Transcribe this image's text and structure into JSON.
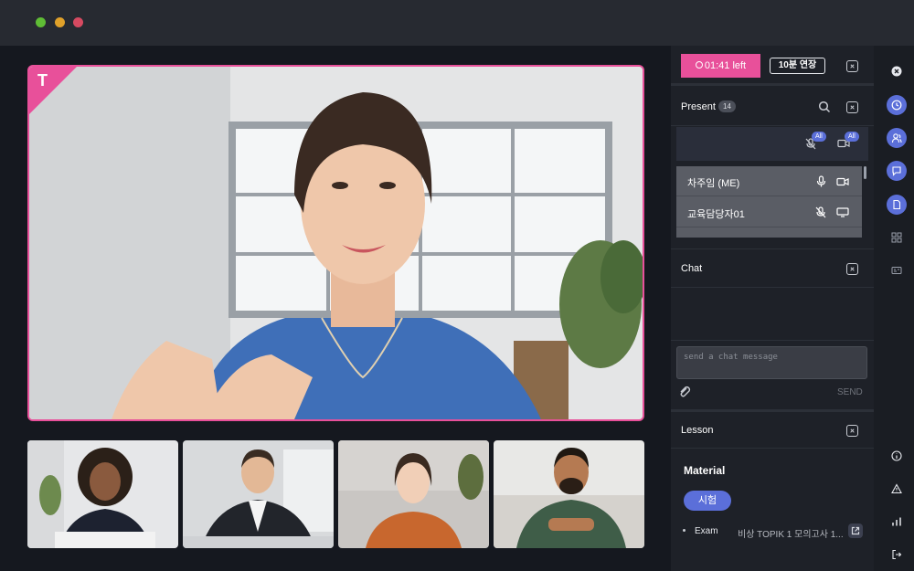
{
  "main_video": {
    "badge": "T"
  },
  "panel": {
    "timer": {
      "label": "01:41 left"
    },
    "extend_label": "10분 연장",
    "present": {
      "title": "Present",
      "count": "14",
      "mic_all": "All",
      "cam_all": "All",
      "participants": [
        {
          "name": "차주임 (ME)"
        },
        {
          "name": "교육담당자01"
        }
      ]
    },
    "chat": {
      "title": "Chat",
      "placeholder": "send a chat message",
      "send_label": "SEND"
    },
    "lesson": {
      "title": "Lesson",
      "material_title": "Material",
      "pill_label": "시험",
      "exam_label": "Exam",
      "exam_title": "비상 TOPIK 1 모의고사 1..."
    }
  },
  "colors": {
    "accent_pink": "#e8509a",
    "accent_blue": "#5b6fd9",
    "panel_bg": "#1e2128"
  }
}
